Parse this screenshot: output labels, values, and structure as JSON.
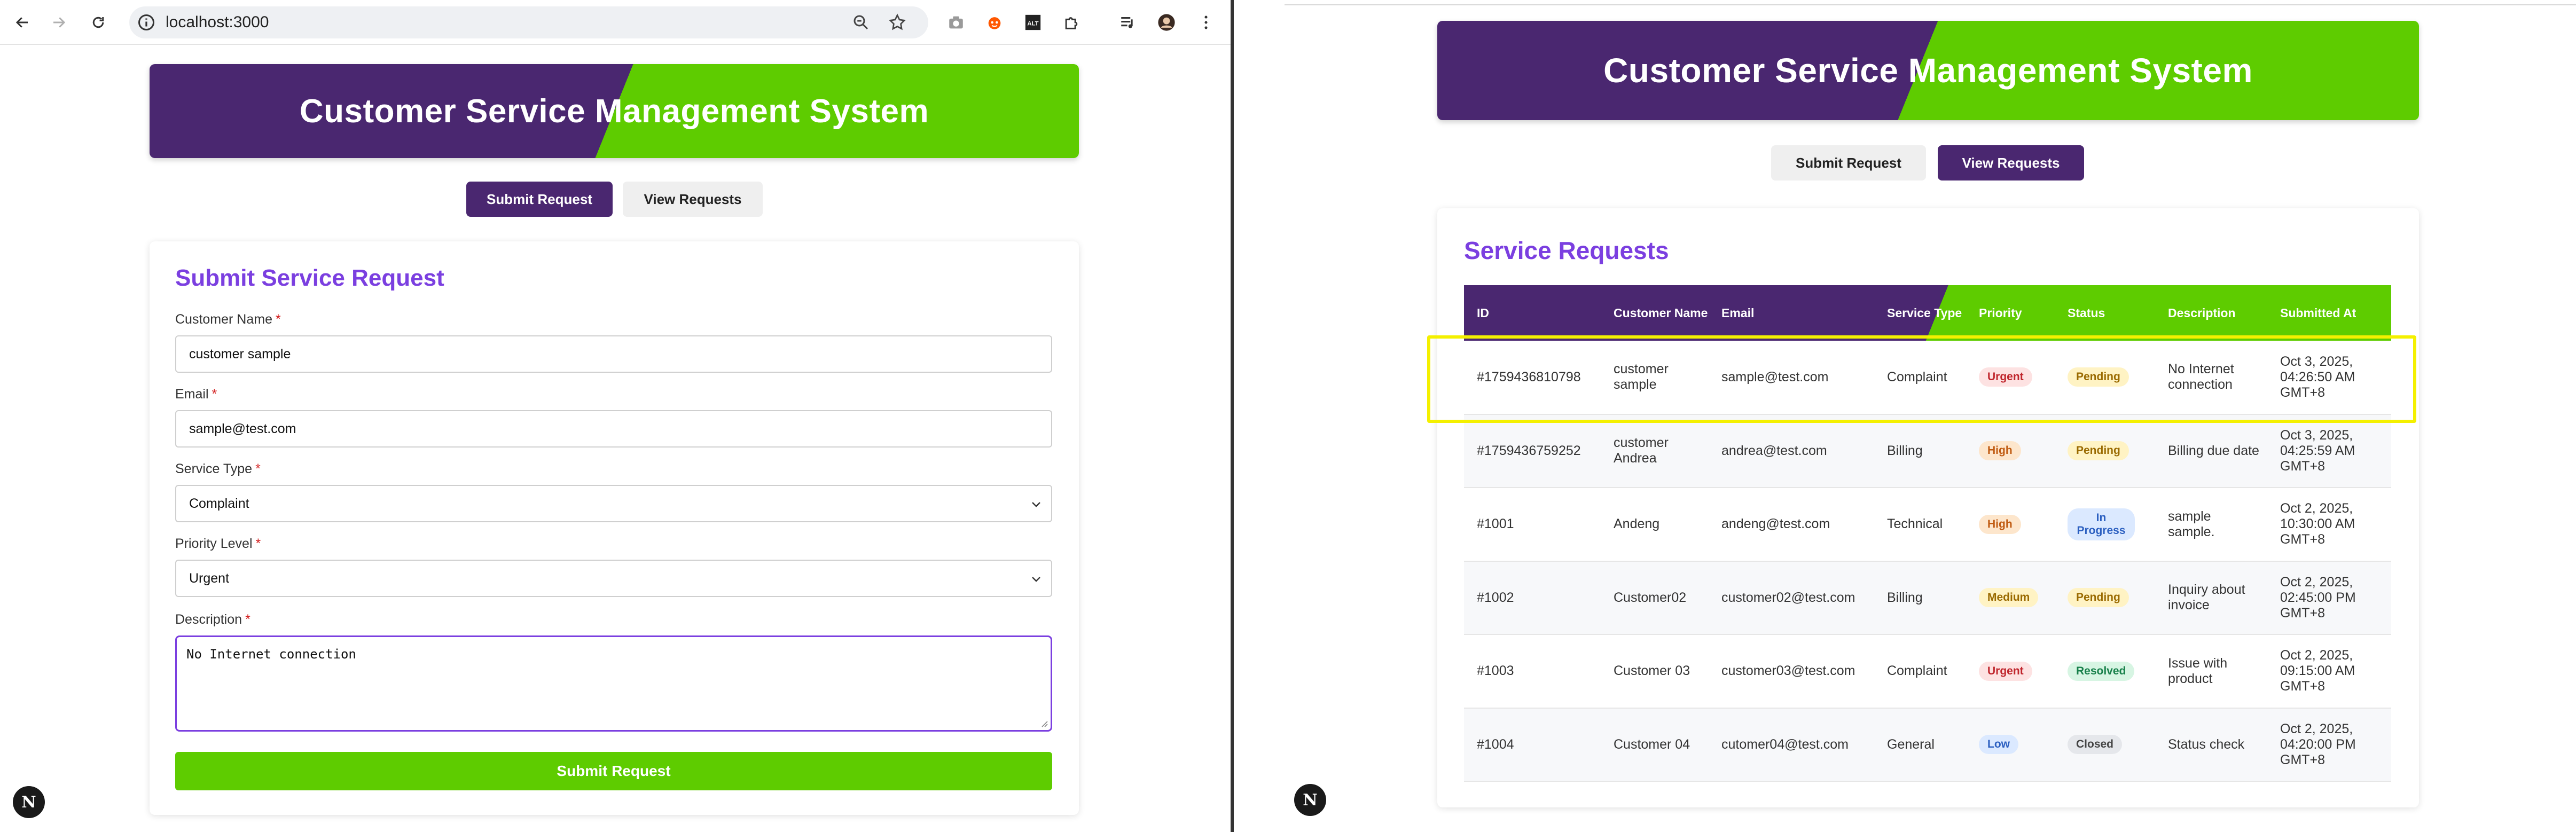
{
  "browser": {
    "url": "localhost:3000"
  },
  "app": {
    "title": "Customer Service Management System",
    "nav": {
      "submit": "Submit Request",
      "view": "View Requests"
    }
  },
  "form": {
    "heading": "Submit Service Request",
    "required_mark": "*",
    "fields": {
      "name": {
        "label": "Customer Name",
        "value": "customer sample"
      },
      "email": {
        "label": "Email",
        "value": "sample@test.com"
      },
      "service": {
        "label": "Service Type",
        "value": "Complaint"
      },
      "priority": {
        "label": "Priority Level",
        "value": "Urgent"
      },
      "description": {
        "label": "Description",
        "value": "No Internet connection"
      }
    },
    "submit_label": "Submit Request"
  },
  "nextjs_badge": "N",
  "requests": {
    "heading": "Service Requests",
    "columns": [
      "ID",
      "Customer Name",
      "Email",
      "Service Type",
      "Priority",
      "Status",
      "Description",
      "Submitted At"
    ],
    "rows": [
      {
        "id": "#1759436810798",
        "name": "customer sample",
        "email": "sample@test.com",
        "service": "Complaint",
        "priority": "Urgent",
        "status": "Pending",
        "description": "No Internet connection",
        "submitted": "Oct 3, 2025, 04:26:50 AM GMT+8"
      },
      {
        "id": "#1759436759252",
        "name": "customer Andrea",
        "email": "andrea@test.com",
        "service": "Billing",
        "priority": "High",
        "status": "Pending",
        "description": "Billing due date",
        "submitted": "Oct 3, 2025, 04:25:59 AM GMT+8"
      },
      {
        "id": "#1001",
        "name": "Andeng",
        "email": "andeng@test.com",
        "service": "Technical",
        "priority": "High",
        "status": "In Progress",
        "description": "sample sample.",
        "submitted": "Oct 2, 2025, 10:30:00 AM GMT+8"
      },
      {
        "id": "#1002",
        "name": "Customer02",
        "email": "customer02@test.com",
        "service": "Billing",
        "priority": "Medium",
        "status": "Pending",
        "description": "Inquiry about invoice",
        "submitted": "Oct 2, 2025, 02:45:00 PM GMT+8"
      },
      {
        "id": "#1003",
        "name": "Customer 03",
        "email": "customer03@test.com",
        "service": "Complaint",
        "priority": "Urgent",
        "status": "Resolved",
        "description": "Issue with product",
        "submitted": "Oct 2, 2025, 09:15:00 AM GMT+8"
      },
      {
        "id": "#1004",
        "name": "Customer 04",
        "email": "cutomer04@test.com",
        "service": "General",
        "priority": "Low",
        "status": "Closed",
        "description": "Status check",
        "submitted": "Oct 2, 2025, 04:20:00 PM GMT+8"
      }
    ]
  },
  "badge_colors": {
    "Urgent": {
      "bg": "#fde2e2",
      "fg": "#c0262d"
    },
    "High": {
      "bg": "#fde6cc",
      "fg": "#c05a10"
    },
    "Medium": {
      "bg": "#fff3c4",
      "fg": "#9a6a00"
    },
    "Low": {
      "bg": "#dbe9ff",
      "fg": "#2b5fc0"
    },
    "Pending": {
      "bg": "#fff3c4",
      "fg": "#9a6a00"
    },
    "In Progress": {
      "bg": "#dbe9ff",
      "fg": "#2b5fc0"
    },
    "Resolved": {
      "bg": "#d7f5e3",
      "fg": "#17804a"
    },
    "Closed": {
      "bg": "#e5e7eb",
      "fg": "#444"
    }
  },
  "colors": {
    "purple": "#4a2770",
    "green": "#5ecc00",
    "heading_violet": "#7b3fe0",
    "highlight": "#f4f000"
  }
}
